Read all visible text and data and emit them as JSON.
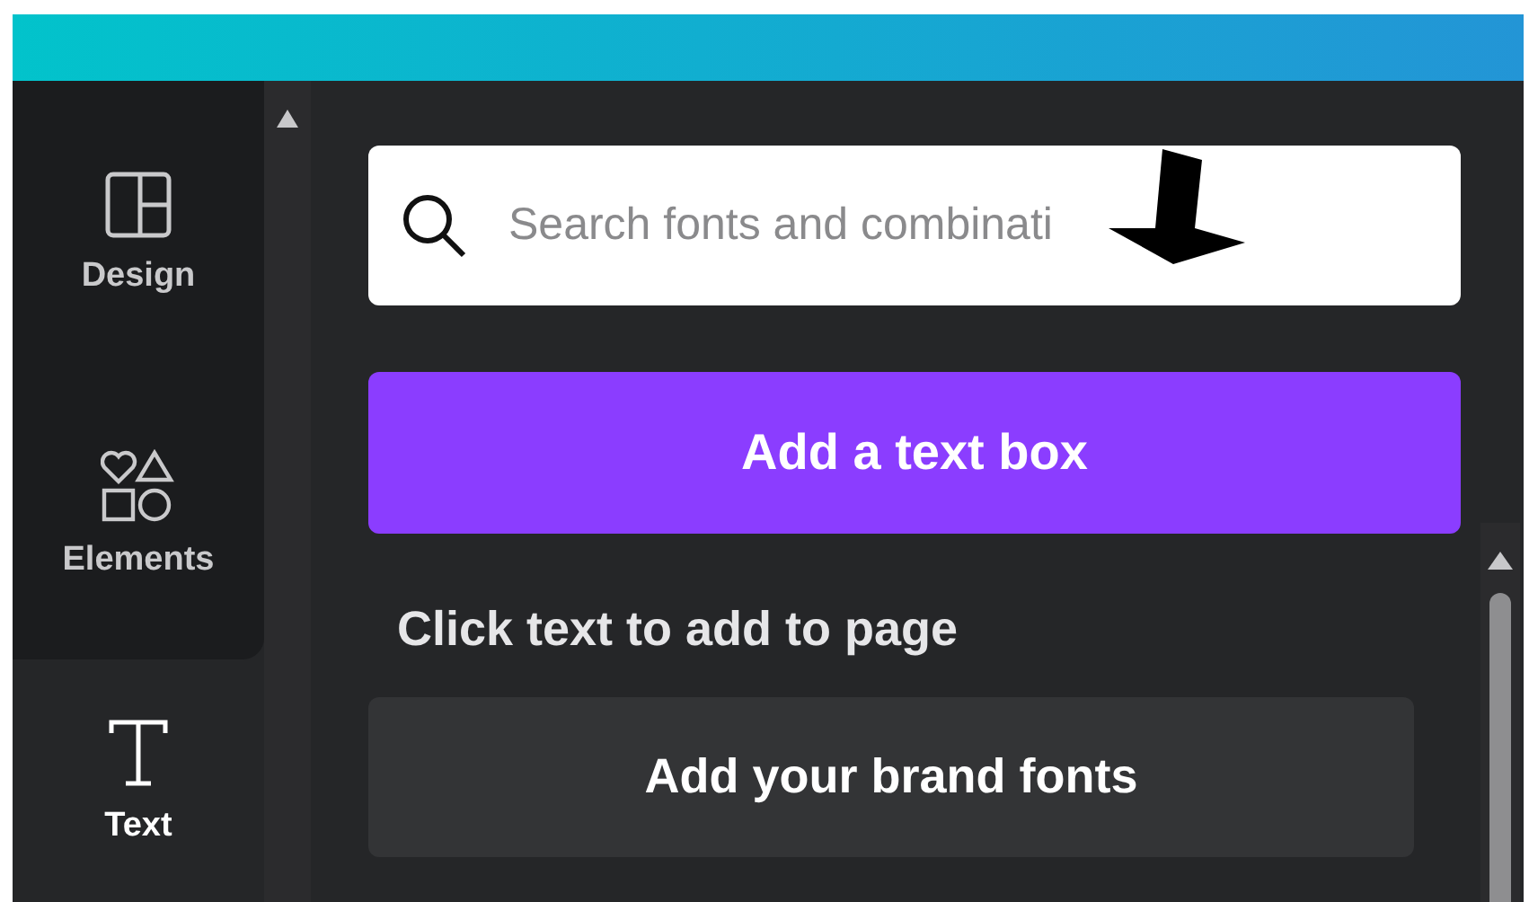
{
  "sidebar": {
    "items": [
      {
        "label": "Design",
        "selected": false
      },
      {
        "label": "Elements",
        "selected": false
      },
      {
        "label": "Text",
        "selected": true
      }
    ]
  },
  "search": {
    "placeholder": "Search fonts and combinati"
  },
  "primary_button": "Add a text box",
  "section_heading": "Click text to add to page",
  "brand_button": "Add your brand fonts"
}
